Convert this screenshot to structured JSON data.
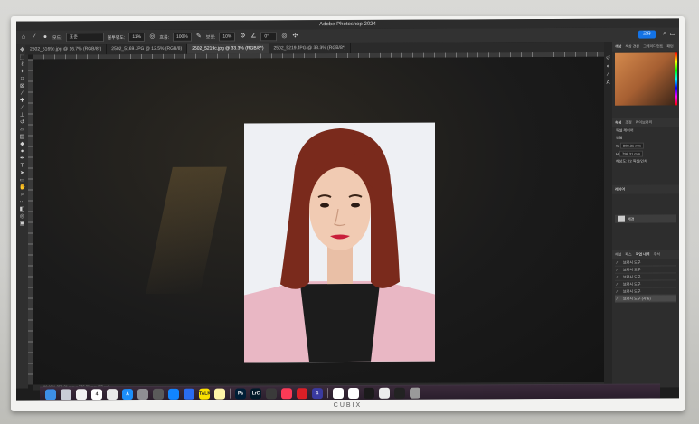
{
  "app": {
    "title": "Adobe Photoshop 2024"
  },
  "options_bar": {
    "mode_label": "모드:",
    "mode_value": "표준",
    "opacity_label": "불투명도:",
    "opacity_value": "11%",
    "flow_label": "흐름:",
    "flow_value": "100%",
    "smoothing_label": "보정:",
    "smoothing_value": "10%",
    "angle_value": "0°",
    "share_label": "공유"
  },
  "tabs": [
    {
      "label": "2502_5169c.jpg @ 16.7% (RGB/8*)",
      "active": false
    },
    {
      "label": "2502_5169.JPG @ 12.5% (RGB/8)",
      "active": false
    },
    {
      "label": "2502_5219c.jpg @ 33.3% (RGB/8*)",
      "active": true
    },
    {
      "label": "2502_5219.JPG @ 33.3% (RGB/8*)",
      "active": false
    }
  ],
  "status_bar": {
    "text": "33.33%    359.31 mm x 776.31 mm (72 ppi)"
  },
  "panels": {
    "color_tabs": [
      "색상",
      "색상 견본",
      "그레이디언트",
      "패턴"
    ],
    "properties_tabs": [
      "속성",
      "조정",
      "라이브러리"
    ],
    "properties_type": "픽셀 레이어",
    "transform_header": "변형",
    "width_label": "W",
    "width_value": "808.31 mm",
    "height_label": "H",
    "height_value": "798.31 mm",
    "resolution_text": "해상도: 72 픽셀/인치",
    "layers_header": "레이어",
    "layers": [
      {
        "name": "배경"
      }
    ],
    "history_tabs": [
      "채널",
      "패스",
      "작업 내역",
      "주석"
    ],
    "history_items": [
      {
        "label": "브러시 도구",
        "selected": false
      },
      {
        "label": "브러시 도구",
        "selected": false
      },
      {
        "label": "브러시 도구",
        "selected": false
      },
      {
        "label": "브러시 도구",
        "selected": false
      },
      {
        "label": "브러시 도구",
        "selected": false
      },
      {
        "label": "브러시 도구 (자동)",
        "selected": true
      }
    ]
  },
  "dock": [
    {
      "name": "finder",
      "color": "#3d8ee8",
      "glyph": ""
    },
    {
      "name": "launchpad",
      "color": "#c9cdd6",
      "glyph": ""
    },
    {
      "name": "photos",
      "color": "#f2f2f2",
      "glyph": ""
    },
    {
      "name": "calendar",
      "color": "#ffffff",
      "glyph": "4"
    },
    {
      "name": "chrome",
      "color": "#e8e8e8",
      "glyph": ""
    },
    {
      "name": "app-store",
      "color": "#1c8ef9",
      "glyph": "A"
    },
    {
      "name": "system-settings",
      "color": "#8e8e93",
      "glyph": ""
    },
    {
      "name": "calculator",
      "color": "#5a5a5a",
      "glyph": ""
    },
    {
      "name": "bluesky",
      "color": "#1185fe",
      "glyph": ""
    },
    {
      "name": "vpn",
      "color": "#2a6cf0",
      "glyph": ""
    },
    {
      "name": "kakaotalk",
      "color": "#fae100",
      "glyph": "TALK"
    },
    {
      "name": "notes",
      "color": "#fff4a8",
      "glyph": ""
    },
    {
      "name": "photoshop",
      "color": "#001e36",
      "glyph": "Ps"
    },
    {
      "name": "lightroom-classic",
      "color": "#001a29",
      "glyph": "LrC"
    },
    {
      "name": "stickies",
      "color": "#3a3a3a",
      "glyph": ""
    },
    {
      "name": "music",
      "color": "#fb3a56",
      "glyph": ""
    },
    {
      "name": "creative-cloud",
      "color": "#da1f26",
      "glyph": ""
    },
    {
      "name": "one-app",
      "color": "#3a3aa0",
      "glyph": "1"
    },
    {
      "name": "preview",
      "color": "#ffffff",
      "glyph": ""
    },
    {
      "name": "id-photo",
      "color": "#ffffff",
      "glyph": ""
    },
    {
      "name": "downloads",
      "color": "#1a1a1a",
      "glyph": ""
    },
    {
      "name": "window-a",
      "color": "#ececec",
      "glyph": ""
    },
    {
      "name": "window-b",
      "color": "#222222",
      "glyph": ""
    },
    {
      "name": "trash",
      "color": "#9a9a9a",
      "glyph": ""
    }
  ],
  "monitor": {
    "brand": "CUBIX"
  }
}
